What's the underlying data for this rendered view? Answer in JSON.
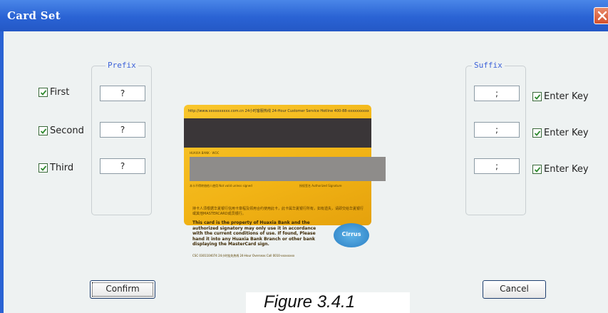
{
  "window": {
    "title": "Card Set",
    "close_icon": "close-icon"
  },
  "prefix": {
    "label": "Prefix",
    "rows": [
      {
        "checkbox_label": "First",
        "checked": true,
        "value": "?"
      },
      {
        "checkbox_label": "Second",
        "checked": true,
        "value": "?"
      },
      {
        "checkbox_label": "Third",
        "checked": true,
        "value": "?"
      }
    ]
  },
  "suffix": {
    "label": "Suffix",
    "rows": [
      {
        "value": ";",
        "checkbox_label": "Enter Key",
        "checked": true
      },
      {
        "value": ";",
        "checkbox_label": "Enter Key",
        "checked": true
      },
      {
        "value": ";",
        "checkbox_label": "Enter Key",
        "checked": true
      }
    ]
  },
  "card": {
    "top_line": "http://www.xxxxxxxxxx.com.cn   24小时客服热线 24-Hour Customer Service Hotline 400-88-xxxxxxxxxx",
    "stripe_note": "HUAXIA BANK · WOC",
    "sig_left": "本卡不得转借他人使用 Not valid unless signed",
    "sig_right": "授权签名 Authorized Signature",
    "cn_text": "持卡人须根据华夏银行信用卡章程及领用合约使用此卡，此卡属华夏银行所有，如有遗失，请即交给华夏银行或其他MASTERCARD成员银行。",
    "en_text": "This card is the property of Huaxia Bank and the authorized signatory may only use it in accordance with the current conditions of use. If found, Please hand it into any Huaxia Bank Branch or other bank displaying the MasterCard sign.",
    "bottom_line": "CSC 0301104074   24小时挂失热线 24-Hour Overseas Call 0010-xxxxxxxx",
    "logo_text": "Cirrus",
    "accent_color": "#f1b315"
  },
  "buttons": {
    "confirm": "Confirm",
    "cancel": "Cancel"
  },
  "caption": "Figure 3.4.1"
}
